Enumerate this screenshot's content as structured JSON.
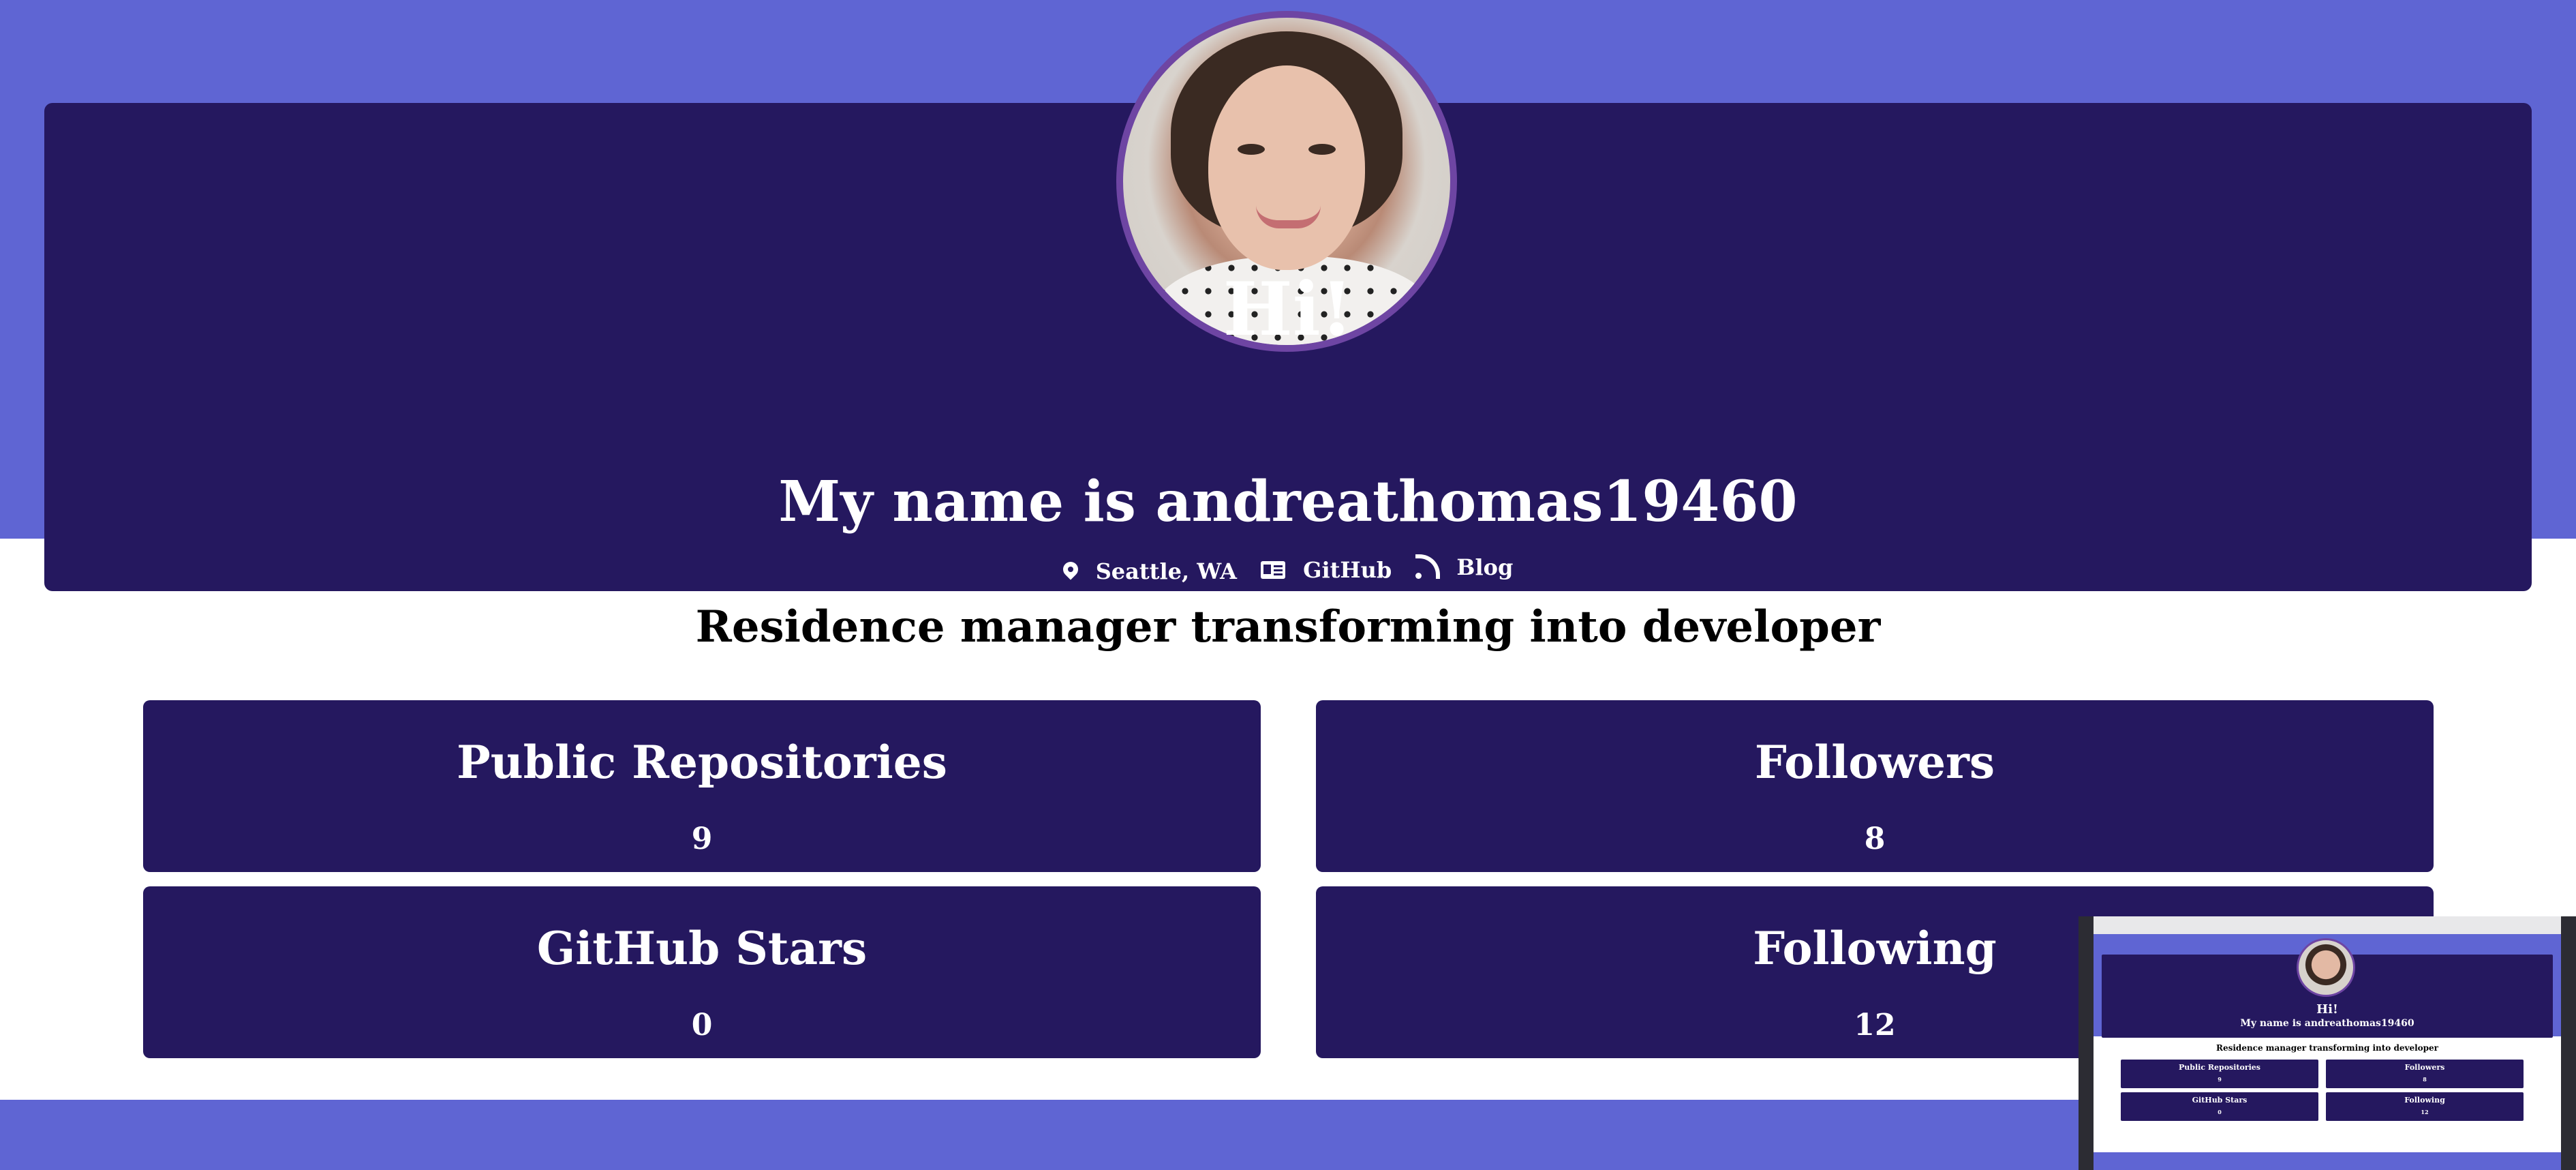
{
  "header": {
    "greeting": "Hi!",
    "name_line": "My name is andreathomas19460",
    "links": [
      {
        "icon": "map-pin-icon",
        "label": "Seattle, WA"
      },
      {
        "icon": "id-card-icon",
        "label": "GitHub"
      },
      {
        "icon": "rss-icon",
        "label": "Blog"
      }
    ]
  },
  "bio": "Residence manager transforming into developer",
  "stats": [
    {
      "label": "Public Repositories",
      "value": "9"
    },
    {
      "label": "Followers",
      "value": "8"
    },
    {
      "label": "GitHub Stars",
      "value": "0"
    },
    {
      "label": "Following",
      "value": "12"
    }
  ],
  "colors": {
    "accent": "#5f65d3",
    "card": "#25185f",
    "avatar_border": "#6e45a3"
  }
}
